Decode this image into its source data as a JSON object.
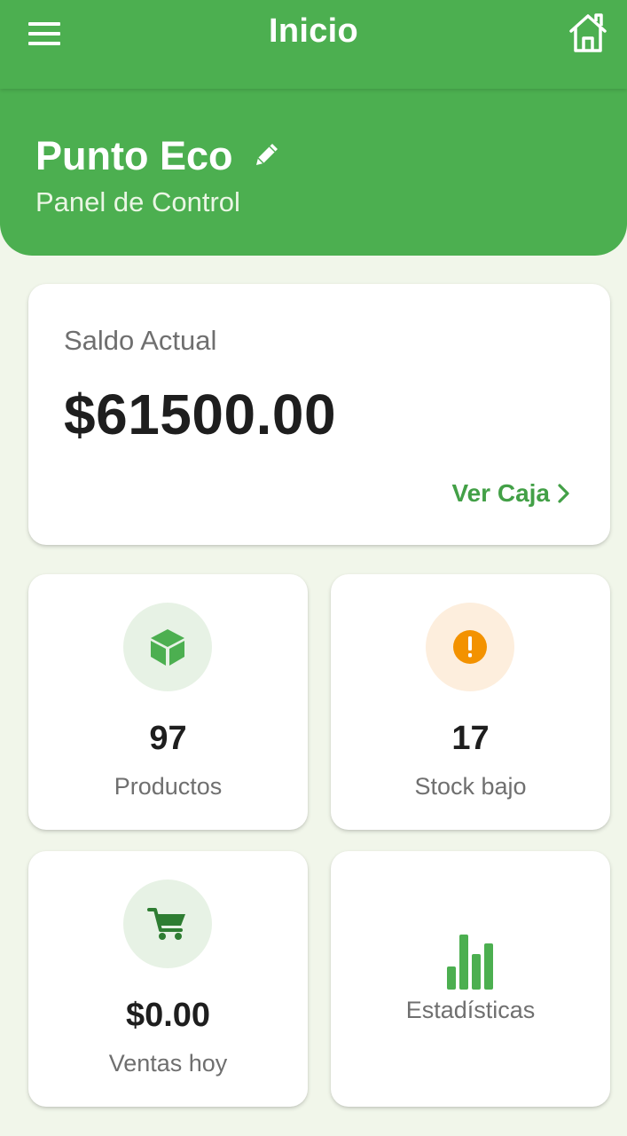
{
  "appbar": {
    "title": "Inicio",
    "menu_icon": "menu-icon",
    "home_icon": "home-icon"
  },
  "header": {
    "store_name": "Punto Eco",
    "subtitle": "Panel de Control",
    "edit_icon": "pencil-icon"
  },
  "balance": {
    "label": "Saldo Actual",
    "value": "$61500.00",
    "link_label": "Ver Caja",
    "link_icon": "chevron-right-icon"
  },
  "stats": [
    {
      "value": "97",
      "label": "Productos",
      "icon": "cube-icon"
    },
    {
      "value": "17",
      "label": "Stock bajo",
      "icon": "alert-icon"
    },
    {
      "value": "$0.00",
      "label": "Ventas hoy",
      "icon": "cart-icon"
    },
    {
      "label": "Estadísticas",
      "icon": "bar-chart-icon"
    }
  ],
  "colors": {
    "primary": "#4caf50",
    "accent_text": "#43a047",
    "background": "#f1f6ea",
    "warning": "#f39200"
  }
}
